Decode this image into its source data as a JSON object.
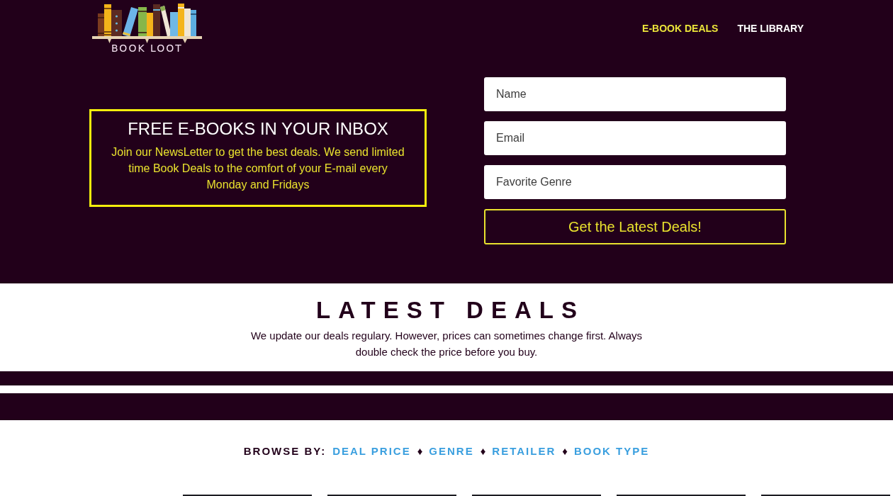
{
  "header": {
    "logo_text": "BOOK LOOT",
    "nav": [
      {
        "label": "E-BOOK DEALS",
        "selected": true
      },
      {
        "label": "THE LIBRARY",
        "selected": false
      }
    ]
  },
  "newsletter": {
    "title": "FREE E-BOOKS IN YOUR INBOX",
    "text": "Join our NewsLetter to get the best deals. We send limited time Book Deals to the comfort of your E-mail every Monday and Fridays",
    "fields": [
      {
        "placeholder": "Name"
      },
      {
        "placeholder": "Email"
      },
      {
        "placeholder": "Favorite Genre"
      }
    ],
    "button": "Get the Latest Deals!"
  },
  "latest_deals": {
    "title": "LATEST DEALS",
    "text": "We update our deals regulary. However, prices can sometimes change first. Always double check the price before you buy."
  },
  "browse": {
    "label": "BROWSE BY:",
    "items": [
      {
        "kind": "link",
        "text": "DEAL PRICE"
      },
      {
        "kind": "separator",
        "text": "♦"
      },
      {
        "kind": "link",
        "text": "GENRE"
      },
      {
        "kind": "separator",
        "text": "♦"
      },
      {
        "kind": "link",
        "text": "RETAILER"
      },
      {
        "kind": "separator",
        "text": "♦"
      },
      {
        "kind": "link",
        "text": "BOOK TYPE"
      }
    ]
  }
}
